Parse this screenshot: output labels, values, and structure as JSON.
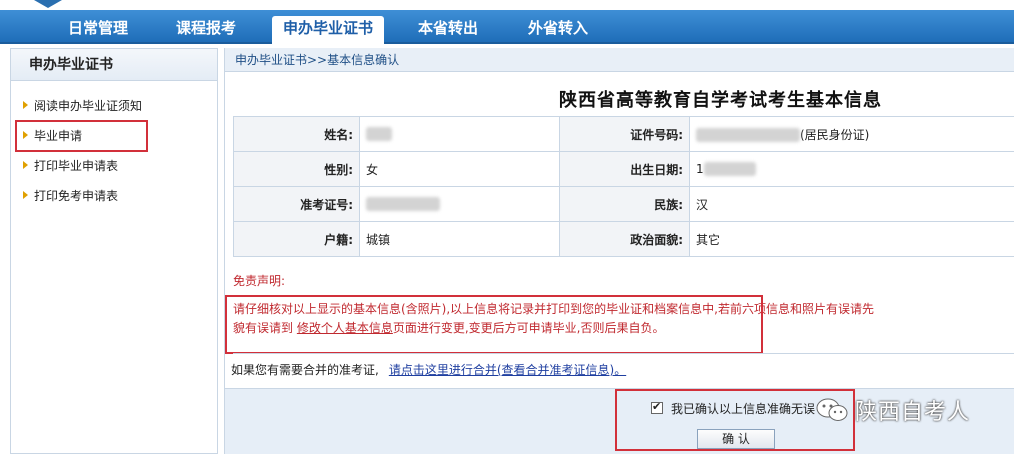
{
  "nav": {
    "items": [
      "日常管理",
      "课程报考",
      "申办毕业证书",
      "本省转出",
      "外省转入"
    ],
    "active": "申办毕业证书"
  },
  "sidebar": {
    "title": "申办毕业证书",
    "items": [
      "阅读申办毕业证须知",
      "毕业申请",
      "打印毕业申请表",
      "打印免考申请表"
    ]
  },
  "main": {
    "breadcrumb": "申办毕业证书>>基本信息确认",
    "title": "陕西省高等教育自学考试考生基本信息",
    "fields": {
      "name_label": "姓名:",
      "id_label": "证件号码:",
      "id_suffix": "(居民身份证)",
      "gender_label": "性别:",
      "gender_value": "女",
      "birth_label": "出生日期:",
      "birth_prefix": "1",
      "exam_label": "准考证号:",
      "ethnic_label": "民族:",
      "ethnic_value": "汉",
      "hukou_label": "户籍:",
      "hukou_value": "城镇",
      "politics_label": "政治面貌:",
      "politics_value": "其它"
    },
    "disclaimer": {
      "heading": "免责声明:",
      "text_part1": "请仔细核对以上显示的基本信息(含照片),以上信息将记录并打印到您的毕业证和档案信息中,若前六项信息和照片有误请先",
      "text_part2": "貌有误请到",
      "link": "修改个人基本信息",
      "text_part3": "页面进行变更,变更后方可申请毕业,否则后果自负。"
    },
    "merge": {
      "text": "如果您有需要合并的准考证,",
      "link": "请点击这里进行合并(查看合并准考证信息)。"
    },
    "confirm": {
      "checkbox_label": "我已确认以上信息准确无误",
      "button": "确 认"
    }
  },
  "watermark": {
    "text": "陕西自考人"
  },
  "colors": {
    "nav_blue": "#1f6db8",
    "highlight_red": "#d2303a",
    "disclaimer_red": "#c0292f"
  }
}
